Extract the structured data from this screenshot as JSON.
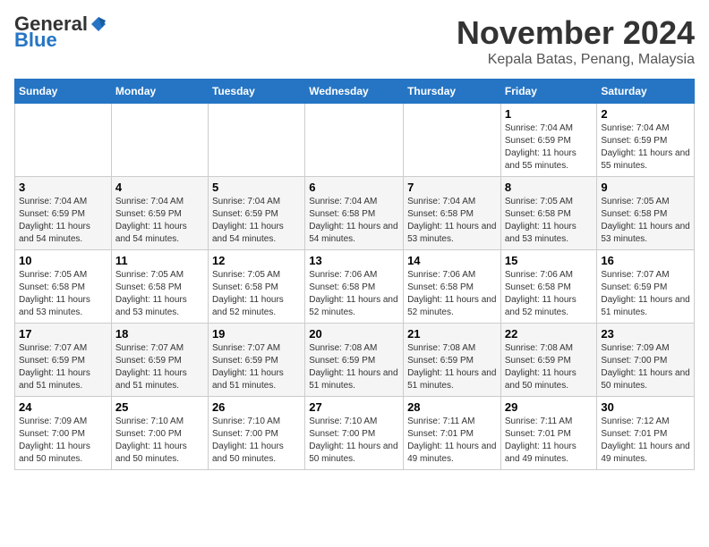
{
  "header": {
    "logo_general": "General",
    "logo_blue": "Blue",
    "month_title": "November 2024",
    "subtitle": "Kepala Batas, Penang, Malaysia"
  },
  "days_of_week": [
    "Sunday",
    "Monday",
    "Tuesday",
    "Wednesday",
    "Thursday",
    "Friday",
    "Saturday"
  ],
  "weeks": [
    [
      {
        "day": "",
        "info": ""
      },
      {
        "day": "",
        "info": ""
      },
      {
        "day": "",
        "info": ""
      },
      {
        "day": "",
        "info": ""
      },
      {
        "day": "",
        "info": ""
      },
      {
        "day": "1",
        "info": "Sunrise: 7:04 AM\nSunset: 6:59 PM\nDaylight: 11 hours and 55 minutes."
      },
      {
        "day": "2",
        "info": "Sunrise: 7:04 AM\nSunset: 6:59 PM\nDaylight: 11 hours and 55 minutes."
      }
    ],
    [
      {
        "day": "3",
        "info": "Sunrise: 7:04 AM\nSunset: 6:59 PM\nDaylight: 11 hours and 54 minutes."
      },
      {
        "day": "4",
        "info": "Sunrise: 7:04 AM\nSunset: 6:59 PM\nDaylight: 11 hours and 54 minutes."
      },
      {
        "day": "5",
        "info": "Sunrise: 7:04 AM\nSunset: 6:59 PM\nDaylight: 11 hours and 54 minutes."
      },
      {
        "day": "6",
        "info": "Sunrise: 7:04 AM\nSunset: 6:58 PM\nDaylight: 11 hours and 54 minutes."
      },
      {
        "day": "7",
        "info": "Sunrise: 7:04 AM\nSunset: 6:58 PM\nDaylight: 11 hours and 53 minutes."
      },
      {
        "day": "8",
        "info": "Sunrise: 7:05 AM\nSunset: 6:58 PM\nDaylight: 11 hours and 53 minutes."
      },
      {
        "day": "9",
        "info": "Sunrise: 7:05 AM\nSunset: 6:58 PM\nDaylight: 11 hours and 53 minutes."
      }
    ],
    [
      {
        "day": "10",
        "info": "Sunrise: 7:05 AM\nSunset: 6:58 PM\nDaylight: 11 hours and 53 minutes."
      },
      {
        "day": "11",
        "info": "Sunrise: 7:05 AM\nSunset: 6:58 PM\nDaylight: 11 hours and 53 minutes."
      },
      {
        "day": "12",
        "info": "Sunrise: 7:05 AM\nSunset: 6:58 PM\nDaylight: 11 hours and 52 minutes."
      },
      {
        "day": "13",
        "info": "Sunrise: 7:06 AM\nSunset: 6:58 PM\nDaylight: 11 hours and 52 minutes."
      },
      {
        "day": "14",
        "info": "Sunrise: 7:06 AM\nSunset: 6:58 PM\nDaylight: 11 hours and 52 minutes."
      },
      {
        "day": "15",
        "info": "Sunrise: 7:06 AM\nSunset: 6:58 PM\nDaylight: 11 hours and 52 minutes."
      },
      {
        "day": "16",
        "info": "Sunrise: 7:07 AM\nSunset: 6:59 PM\nDaylight: 11 hours and 51 minutes."
      }
    ],
    [
      {
        "day": "17",
        "info": "Sunrise: 7:07 AM\nSunset: 6:59 PM\nDaylight: 11 hours and 51 minutes."
      },
      {
        "day": "18",
        "info": "Sunrise: 7:07 AM\nSunset: 6:59 PM\nDaylight: 11 hours and 51 minutes."
      },
      {
        "day": "19",
        "info": "Sunrise: 7:07 AM\nSunset: 6:59 PM\nDaylight: 11 hours and 51 minutes."
      },
      {
        "day": "20",
        "info": "Sunrise: 7:08 AM\nSunset: 6:59 PM\nDaylight: 11 hours and 51 minutes."
      },
      {
        "day": "21",
        "info": "Sunrise: 7:08 AM\nSunset: 6:59 PM\nDaylight: 11 hours and 51 minutes."
      },
      {
        "day": "22",
        "info": "Sunrise: 7:08 AM\nSunset: 6:59 PM\nDaylight: 11 hours and 50 minutes."
      },
      {
        "day": "23",
        "info": "Sunrise: 7:09 AM\nSunset: 7:00 PM\nDaylight: 11 hours and 50 minutes."
      }
    ],
    [
      {
        "day": "24",
        "info": "Sunrise: 7:09 AM\nSunset: 7:00 PM\nDaylight: 11 hours and 50 minutes."
      },
      {
        "day": "25",
        "info": "Sunrise: 7:10 AM\nSunset: 7:00 PM\nDaylight: 11 hours and 50 minutes."
      },
      {
        "day": "26",
        "info": "Sunrise: 7:10 AM\nSunset: 7:00 PM\nDaylight: 11 hours and 50 minutes."
      },
      {
        "day": "27",
        "info": "Sunrise: 7:10 AM\nSunset: 7:00 PM\nDaylight: 11 hours and 50 minutes."
      },
      {
        "day": "28",
        "info": "Sunrise: 7:11 AM\nSunset: 7:01 PM\nDaylight: 11 hours and 49 minutes."
      },
      {
        "day": "29",
        "info": "Sunrise: 7:11 AM\nSunset: 7:01 PM\nDaylight: 11 hours and 49 minutes."
      },
      {
        "day": "30",
        "info": "Sunrise: 7:12 AM\nSunset: 7:01 PM\nDaylight: 11 hours and 49 minutes."
      }
    ]
  ]
}
